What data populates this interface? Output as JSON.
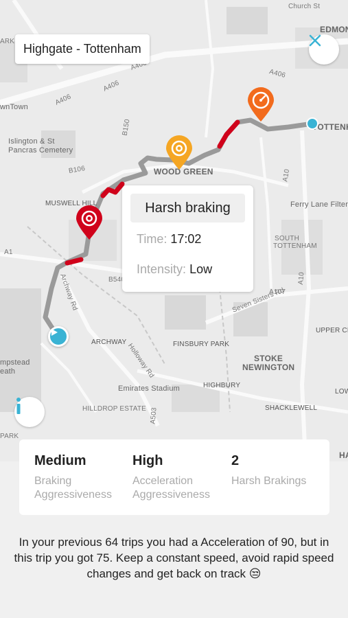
{
  "header": {
    "title": "Highgate - Tottenham"
  },
  "icons": {
    "close": "close-icon",
    "info": "info-icon",
    "start": "play-icon",
    "end": "end-dot-icon",
    "braking_marker": "braking-marker-icon",
    "acceleration_marker": "acceleration-marker-icon",
    "speed_marker": "speedometer-marker-icon"
  },
  "colors": {
    "route": "#9a9a9a",
    "harsh_segment": "#d0021b",
    "accent": "#3ab3d4",
    "acceleration_marker": "#f5a623",
    "speed_marker": "#f26b1d",
    "braking_marker": "#d0021b"
  },
  "map_labels": {
    "edmonton": "EDMON",
    "tottenham": "TOTTENHAM",
    "church_st": "Church St",
    "kentown": "wnTown",
    "islington": "Islington & St",
    "pancras": "Pancras Cemetery",
    "wood_green": "WOOD GREEN",
    "muswell_hill": "MUSWELL HILL",
    "ferry_lane": "Ferry Lane Filter",
    "south_tottenham1": "SOUTH",
    "south_tottenham2": "TOTTENHAM",
    "archway": "ARCHWAY",
    "finsbury_park": "FINSBURY PARK",
    "stoke1": "STOKE",
    "stoke2": "NEWINGTON",
    "upper_cl": "UPPER CLA",
    "highbury": "HIGHBURY",
    "emirates": "Emirates Stadium",
    "hilldrop": "HILLDROP ESTATE",
    "shacklewell": "SHACKLEWELL",
    "low": "LOW",
    "hampstead1": "mpstead",
    "hampstead2": "eath",
    "park1": "ARK",
    "park2": "PARK",
    "ha": "HA",
    "a406_1": "A406",
    "a406_2": "A406",
    "a406_3": "A406",
    "a406_4": "A406",
    "a10": "A10",
    "a10b": "A10",
    "a1": "A1",
    "a503": "A503",
    "a107": "A107",
    "seven_sisters": "Seven Sisters Rd",
    "archway_rd": "Archway Rd",
    "holloway_rd": "Holloway Rd",
    "b106": "B106",
    "b150": "B150",
    "b540": "B540"
  },
  "popup": {
    "title": "Harsh braking",
    "time_label": "Time:",
    "time_value": "17:02",
    "intensity_label": "Intensity:",
    "intensity_value": "Low"
  },
  "stats": [
    {
      "value": "Medium",
      "label": "Braking Aggressiveness"
    },
    {
      "value": "High",
      "label": "Acceleration Aggressiveness"
    },
    {
      "value": "2",
      "label": "Harsh Brakings"
    }
  ],
  "message": "In your previous 64 trips you had a Acceleration of 90, but in this trip you got 75. Keep a constant speed, avoid rapid speed changes and get back on track 😒"
}
